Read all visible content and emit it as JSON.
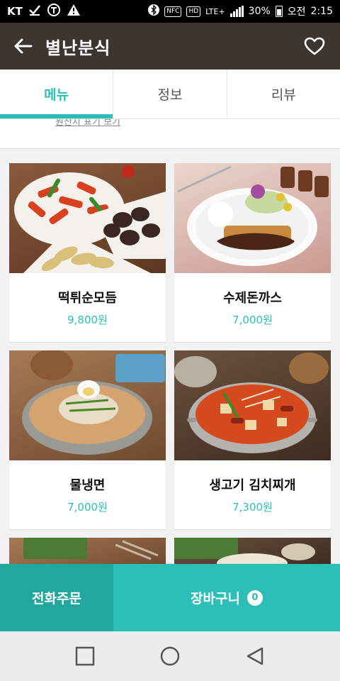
{
  "status_bar": {
    "carrier": "KT",
    "nfc": "NFC",
    "hd": "HD",
    "network": "LTE+",
    "battery": "30%",
    "ampm": "오전",
    "time": "2:15"
  },
  "app_bar": {
    "title": "별난분식"
  },
  "tabs": [
    {
      "label": "메뉴",
      "active": true
    },
    {
      "label": "정보",
      "active": false
    },
    {
      "label": "리뷰",
      "active": false
    }
  ],
  "notice": {
    "link_text": "원산지 표기 보기"
  },
  "menu_items": [
    {
      "name": "떡튀순모듬",
      "price": "9,800원",
      "image_icon": "tteokbokki-platter"
    },
    {
      "name": "수제돈까스",
      "price": "7,000원",
      "image_icon": "pork-cutlet-plate"
    },
    {
      "name": "물냉면",
      "price": "7,000원",
      "image_icon": "cold-noodle-bowl"
    },
    {
      "name": "생고기 김치찌개",
      "price": "7,300원",
      "image_icon": "kimchi-stew-pot"
    }
  ],
  "bottom_bar": {
    "call_label": "전화주문",
    "cart_label": "장바구니",
    "cart_count": "0"
  },
  "colors": {
    "accent": "#2bbfb7",
    "accent_dark": "#22a79f",
    "app_bar": "#3d3530"
  }
}
